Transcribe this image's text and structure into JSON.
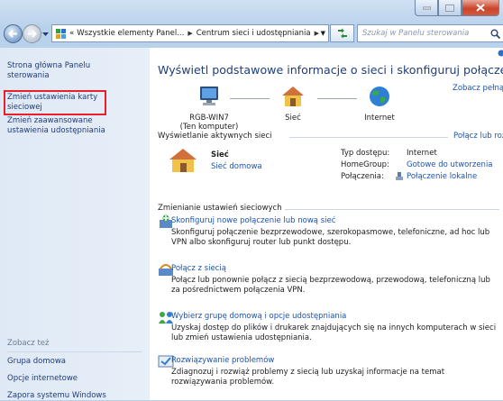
{
  "address": {
    "crumbs": [
      "«",
      "Wszystkie elementy Panel...",
      "Centrum sieci i udostępniania"
    ]
  },
  "search": {
    "placeholder": "Szukaj w Panelu sterowania"
  },
  "sidebar": {
    "links": [
      "Strona główna Panelu sterowania",
      "Zmień ustawienia karty sieciowej",
      "Zmień zaawansowane ustawienia udostępniania"
    ],
    "see_also_heading": "Zobacz też",
    "see_also": [
      "Grupa domowa",
      "Opcje internetowe",
      "Zapora systemu Windows"
    ]
  },
  "main": {
    "title": "Wyświetl podstawowe informacje o sieci i skonfiguruj połączenia",
    "full_map_link": "Zobacz pełną mapę",
    "map": {
      "computer": {
        "name": "RGB-WIN7",
        "sub": "(Ten komputer)"
      },
      "network": "Sieć",
      "internet": "Internet"
    },
    "active_heading": "Wyświetlanie aktywnych sieci",
    "connect_disconnect": "Połącz lub rozłącz",
    "active_network": {
      "name": "Sieć",
      "type": "Sieć domowa",
      "access_label": "Typ dostępu:",
      "access_value": "Internet",
      "homegroup_label": "HomeGroup:",
      "homegroup_value": "Gotowe do utworzenia",
      "connections_label": "Połączenia:",
      "connections_value": "Połączenie lokalne"
    },
    "change_heading": "Zmienianie ustawień sieciowych",
    "options": [
      {
        "title": "Skonfiguruj nowe połączenie lub nową sieć",
        "desc": "Skonfiguruj połączenie bezprzewodowe, szerokopasmowe, telefoniczne, ad hoc lub VPN albo skonfiguruj router lub punkt dostępu."
      },
      {
        "title": "Połącz z siecią",
        "desc": "Połącz lub ponownie połącz z siecią bezprzewodową, przewodową, telefoniczną lub za pośrednictwem połączenia VPN."
      },
      {
        "title": "Wybierz grupę domową i opcje udostępniania",
        "desc": "Uzyskaj dostęp do plików i drukarek znajdujących się na innych komputerach w sieci lub zmień ustawienia udostępniania."
      },
      {
        "title": "Rozwiązywanie problemów",
        "desc": "Zdiagnozuj i rozwiąż problemy z siecią lub uzyskaj informacje na temat rozwiązywania problemów."
      }
    ]
  }
}
